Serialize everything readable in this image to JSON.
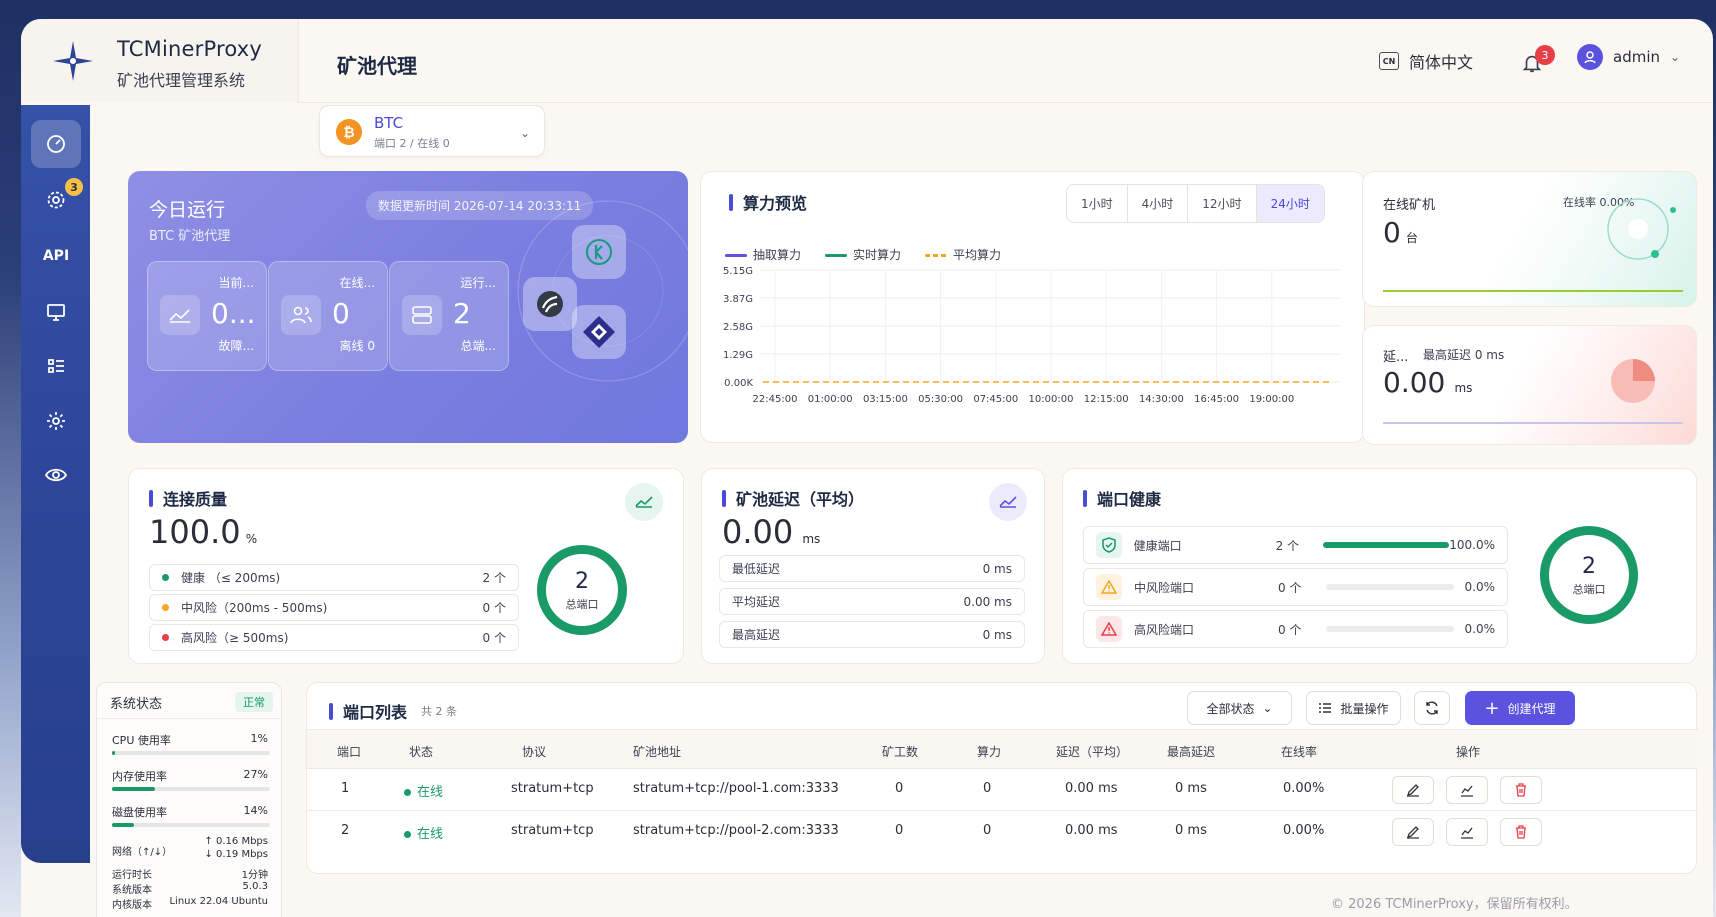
{
  "brand": {
    "name": "TCMinerProxy",
    "subtitle": "矿池代理管理系统"
  },
  "header": {
    "title": "矿池代理",
    "lang": "简体中文",
    "lang_code": "CN",
    "notifications": "3",
    "user": "admin"
  },
  "sidebar": {
    "api_label": "API",
    "settings_badge": "3"
  },
  "coin": {
    "name": "BTC",
    "sub": "端口 2 / 在线 0"
  },
  "today": {
    "title": "今日运行",
    "sub": "BTC 矿池代理",
    "updated": "数据更新时间 2026-07-14 20:33:11",
    "metrics": [
      {
        "label": "当前...",
        "value": "0...",
        "sub": "故障..."
      },
      {
        "label": "在线...",
        "value": "0",
        "sub": "离线 0"
      },
      {
        "label": "运行...",
        "value": "2",
        "sub": "总端..."
      }
    ]
  },
  "hashrate": {
    "title": "算力预览",
    "ranges": [
      "1小时",
      "4小时",
      "12小时",
      "24小时"
    ],
    "legend": [
      "抽取算力",
      "实时算力",
      "平均算力"
    ]
  },
  "chart_data": {
    "type": "line",
    "y_ticks": [
      "5.15G",
      "3.87G",
      "2.58G",
      "1.29G",
      "0.00K"
    ],
    "x": [
      "22:45:00",
      "01:00:00",
      "03:15:00",
      "05:30:00",
      "07:45:00",
      "10:00:00",
      "12:15:00",
      "14:30:00",
      "16:45:00",
      "19:00:00"
    ],
    "series": [
      {
        "name": "抽取算力",
        "color": "#5b52e0",
        "values": []
      },
      {
        "name": "实时算力",
        "color": "#1a9a66",
        "values": []
      },
      {
        "name": "平均算力",
        "color": "#f5a623",
        "values": [
          0,
          0,
          0,
          0,
          0,
          0,
          0,
          0,
          0,
          0
        ]
      }
    ]
  },
  "online_card": {
    "label": "在线矿机",
    "rate": "在线率 0.00%",
    "value": "0",
    "unit": "台"
  },
  "delay_card": {
    "label": "延...",
    "max": "最高延迟 0 ms",
    "value": "0.00",
    "unit": "ms"
  },
  "conn": {
    "title": "连接质量",
    "value": "100.0",
    "unit": "%",
    "rows": [
      {
        "label": "健康 （≤ 200ms)",
        "count": "2 个",
        "color": "#1a9a66"
      },
      {
        "label": "中风险（200ms - 500ms)",
        "count": "0 个",
        "color": "#f5a623"
      },
      {
        "label": "高风险（≥ 500ms)",
        "count": "0 个",
        "color": "#e83e4a"
      }
    ],
    "ring_value": "2",
    "ring_label": "总端口"
  },
  "latency": {
    "title": "矿池延迟（平均）",
    "value": "0.00",
    "unit": "ms",
    "rows": [
      {
        "label": "最低延迟",
        "value": "0 ms"
      },
      {
        "label": "平均延迟",
        "value": "0.00 ms"
      },
      {
        "label": "最高延迟",
        "value": "0 ms"
      }
    ]
  },
  "port_health": {
    "title": "端口健康",
    "rows": [
      {
        "label": "健康端口",
        "count": "2 个",
        "pct": "100.0%",
        "fill": 1.0
      },
      {
        "label": "中风险端口",
        "count": "0 个",
        "pct": "0.0%",
        "fill": 0
      },
      {
        "label": "高风险端口",
        "count": "0 个",
        "pct": "0.0%",
        "fill": 0
      }
    ],
    "ring_value": "2",
    "ring_label": "总端口"
  },
  "system": {
    "title": "系统状态",
    "status": "正常",
    "cpu_label": "CPU 使用率",
    "cpu": "1%",
    "cpu_fill": 0.01,
    "mem_label": "内存使用率",
    "mem": "27%",
    "mem_fill": 0.27,
    "disk_label": "磁盘使用率",
    "disk": "14%",
    "disk_fill": 0.14,
    "net_label": "网络（↑/↓）",
    "net_up": "↑ 0.16 Mbps",
    "net_down": "↓ 0.19 Mbps",
    "uptime_label": "运行时长",
    "uptime": "1分钟",
    "ver_label": "系统版本",
    "ver": "5.0.3",
    "kernel_label": "内核版本",
    "kernel": "Linux 22.04 Ubuntu"
  },
  "ports": {
    "title": "端口列表",
    "count": "共 2 条",
    "filter": "全部状态",
    "batch": "批量操作",
    "create": "创建代理",
    "columns": [
      "端口",
      "状态",
      "协议",
      "矿池地址",
      "矿工数",
      "算力",
      "延迟（平均）",
      "最高延迟",
      "在线率",
      "操作"
    ],
    "rows": [
      {
        "port": "1",
        "status": "在线",
        "proto": "stratum+tcp",
        "addr": "stratum+tcp://pool-1.com:3333",
        "miners": "0",
        "hash": "0",
        "lat": "0.00 ms",
        "max": "0 ms",
        "rate": "0.00%"
      },
      {
        "port": "2",
        "status": "在线",
        "proto": "stratum+tcp",
        "addr": "stratum+tcp://pool-2.com:3333",
        "miners": "0",
        "hash": "0",
        "lat": "0.00 ms",
        "max": "0 ms",
        "rate": "0.00%"
      }
    ]
  },
  "footer": "© 2026 TCMinerProxy，保留所有权利。"
}
